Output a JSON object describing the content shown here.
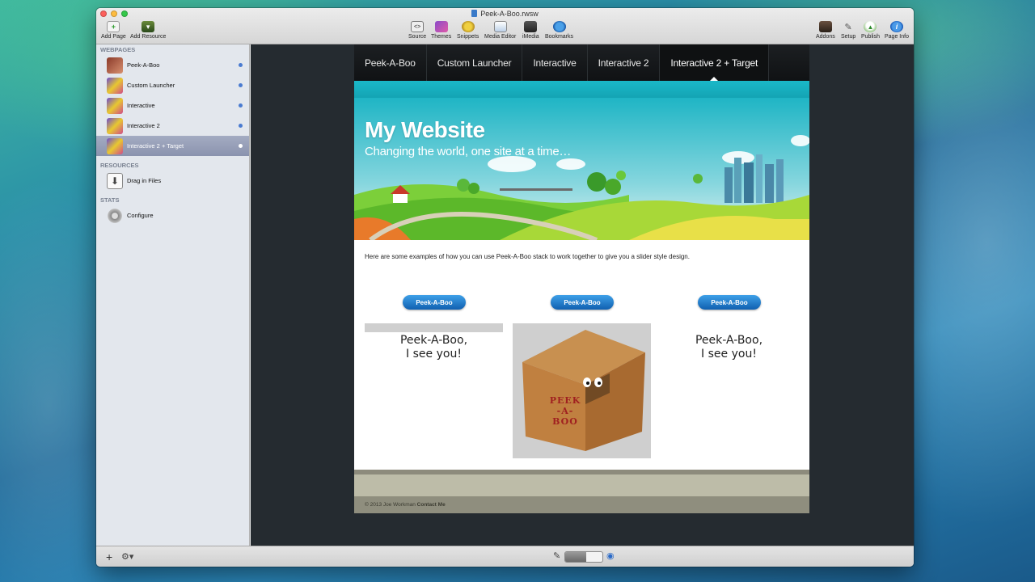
{
  "window": {
    "title": "Peek-A-Boo.rwsw"
  },
  "toolbar": {
    "left": [
      {
        "label": "Add Page",
        "icon": "add-page-icon"
      },
      {
        "label": "Add Resource",
        "icon": "add-resource-icon"
      }
    ],
    "center": [
      {
        "label": "Source",
        "icon": "source-icon"
      },
      {
        "label": "Themes",
        "icon": "themes-icon"
      },
      {
        "label": "Snippets",
        "icon": "snippets-icon"
      },
      {
        "label": "Media Editor",
        "icon": "media-editor-icon"
      },
      {
        "label": "iMedia",
        "icon": "imedia-icon"
      },
      {
        "label": "Bookmarks",
        "icon": "bookmarks-icon"
      }
    ],
    "right": [
      {
        "label": "Addons",
        "icon": "addons-icon"
      },
      {
        "label": "Setup",
        "icon": "setup-icon"
      },
      {
        "label": "Publish",
        "icon": "publish-icon"
      },
      {
        "label": "Page Info",
        "icon": "page-info-icon"
      }
    ]
  },
  "sidebar": {
    "webpages_heading": "WEBPAGES",
    "pages": [
      {
        "label": "Peek-A-Boo",
        "icon": "house-icon"
      },
      {
        "label": "Custom Launcher",
        "icon": "stack-page-icon"
      },
      {
        "label": "Interactive",
        "icon": "stack-page-icon"
      },
      {
        "label": "Interactive 2",
        "icon": "stack-page-icon"
      },
      {
        "label": "Interactive 2 + Target",
        "icon": "stack-page-icon",
        "selected": true
      }
    ],
    "resources_heading": "RESOURCES",
    "resources": [
      {
        "label": "Drag in Files",
        "icon": "drag-in-icon"
      }
    ],
    "stats_heading": "STATS",
    "stats": [
      {
        "label": "Configure",
        "icon": "gear-icon"
      }
    ]
  },
  "site": {
    "nav": [
      {
        "label": "Peek-A-Boo"
      },
      {
        "label": "Custom Launcher"
      },
      {
        "label": "Interactive"
      },
      {
        "label": "Interactive 2"
      },
      {
        "label": "Interactive 2 + Target",
        "active": true
      }
    ],
    "hero_title": "My Website",
    "hero_subtitle": "Changing the world, one site at a time…",
    "intro": "Here are some examples of how you can use Peek-A-Boo stack to work together to give you a slider style design.",
    "buttons": [
      "Peek-A-Boo",
      "Peek-A-Boo",
      "Peek-A-Boo"
    ],
    "reveal_text_line1": "Peek-A-Boo,",
    "reveal_text_line2": "I see you!",
    "box_label": [
      "PEEK",
      "-A-",
      "BOO"
    ],
    "footer_copyright": "© 2013 Joe Workman",
    "footer_link": "Contact Me"
  },
  "colors": {
    "accent_button": "#1f7fd0",
    "site_band": "#1ab8c8",
    "sidebar_selected": "#959eb8"
  }
}
